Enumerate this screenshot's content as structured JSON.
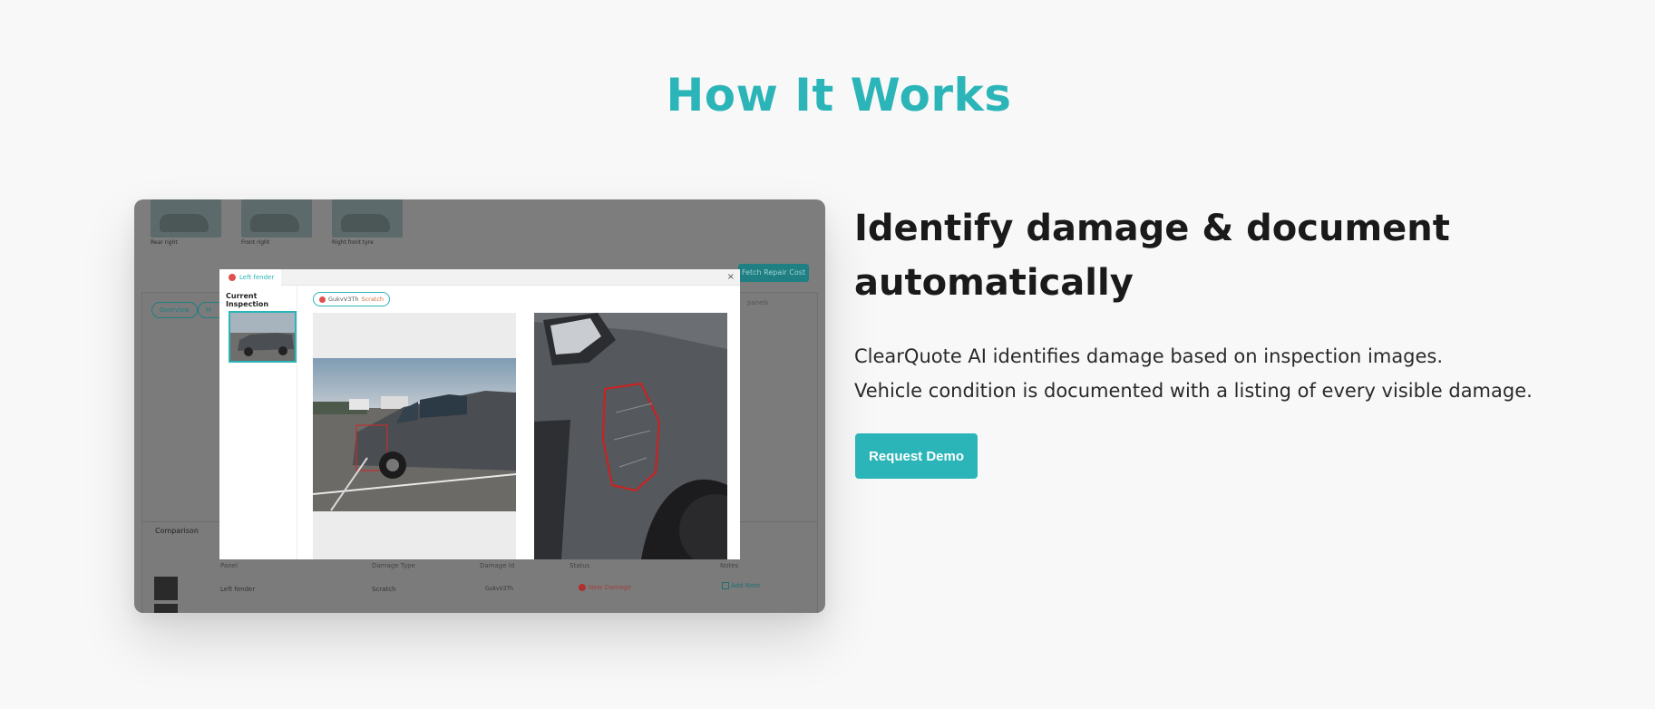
{
  "section": {
    "title": "How It Works",
    "heading": "Identify damage & document automatically",
    "description": [
      "ClearQuote AI identifies damage based on inspection images.",
      "Vehicle condition is documented with a listing of every visible damage."
    ],
    "cta_label": "Request Demo"
  },
  "colors": {
    "accent": "#2bb5b8",
    "damage_red": "#e05050"
  },
  "screenshot": {
    "background": {
      "thumbnails": [
        {
          "label": "Rear right"
        },
        {
          "label": "Front right"
        },
        {
          "label": "Right front tyre"
        }
      ],
      "fetch_button": "Fetch Repair Cost",
      "tabs": [
        "Overview",
        "M"
      ],
      "panels_label": "panels",
      "comparison_label": "Comparison",
      "table_headers": [
        "Panel",
        "Damage Type",
        "Damage Id",
        "Status",
        "Notes"
      ],
      "table_rows": [
        {
          "panel": "Left fender",
          "damage_type": "Scratch",
          "damage_id": "GukvV3Th",
          "status": "New Damage",
          "notes": "Add Note"
        }
      ]
    },
    "modal": {
      "tab_label": "Left fender",
      "close_glyph": "×",
      "current_inspection_label": "Current Inspection",
      "chip_id": "GukvV3Th",
      "chip_type": "Scratch"
    }
  }
}
